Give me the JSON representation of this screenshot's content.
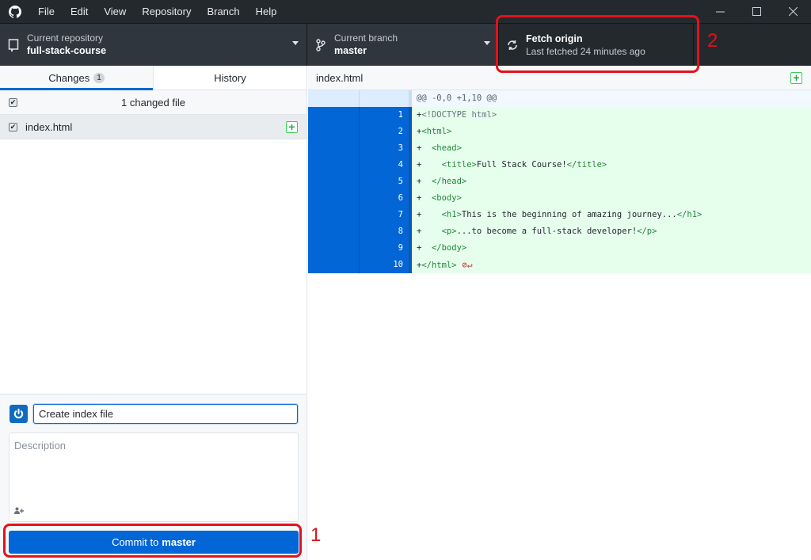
{
  "titlebar": {
    "menu": [
      "File",
      "Edit",
      "View",
      "Repository",
      "Branch",
      "Help"
    ],
    "window_controls": [
      "minimize",
      "maximize",
      "close"
    ]
  },
  "toolbar": {
    "repository": {
      "label": "Current repository",
      "value": "full-stack-course"
    },
    "branch": {
      "label": "Current branch",
      "value": "master"
    },
    "fetch": {
      "label": "Fetch origin",
      "sub": "Last fetched 24 minutes ago"
    }
  },
  "annotations": {
    "fetch_number": "2",
    "commit_number": "1"
  },
  "sidebar": {
    "tabs": [
      {
        "label": "Changes",
        "badge": "1",
        "selected": true
      },
      {
        "label": "History",
        "selected": false
      }
    ],
    "changes_header": "1 changed file",
    "files": [
      {
        "name": "index.html",
        "status": "added",
        "checked": true
      }
    ]
  },
  "commit": {
    "summary_value": "Create index file",
    "description_placeholder": "Description",
    "button_prefix": "Commit to",
    "button_branch": "master"
  },
  "diff": {
    "filename": "index.html",
    "hunk": "@@ -0,0 +1,10 @@",
    "lines": [
      {
        "num": "1",
        "parts": [
          [
            "p",
            "+"
          ],
          [
            "d",
            "<!DOCTYPE html>"
          ]
        ]
      },
      {
        "num": "2",
        "parts": [
          [
            "p",
            "+"
          ],
          [
            "t",
            "<html>"
          ]
        ]
      },
      {
        "num": "3",
        "parts": [
          [
            "p",
            "+  "
          ],
          [
            "t",
            "<head>"
          ]
        ]
      },
      {
        "num": "4",
        "parts": [
          [
            "p",
            "+    "
          ],
          [
            "t",
            "<title>"
          ],
          [
            "x",
            "Full Stack Course!"
          ],
          [
            "t",
            "</title>"
          ]
        ]
      },
      {
        "num": "5",
        "parts": [
          [
            "p",
            "+  "
          ],
          [
            "t",
            "</head>"
          ]
        ]
      },
      {
        "num": "6",
        "parts": [
          [
            "p",
            "+  "
          ],
          [
            "t",
            "<body>"
          ]
        ]
      },
      {
        "num": "7",
        "parts": [
          [
            "p",
            "+    "
          ],
          [
            "t",
            "<h1>"
          ],
          [
            "x",
            "This is the beginning of amazing journey..."
          ],
          [
            "t",
            "</h1>"
          ]
        ]
      },
      {
        "num": "8",
        "parts": [
          [
            "p",
            "+    "
          ],
          [
            "t",
            "<p>"
          ],
          [
            "x",
            "...to become a full-stack developer!"
          ],
          [
            "t",
            "</p>"
          ]
        ]
      },
      {
        "num": "9",
        "parts": [
          [
            "p",
            "+  "
          ],
          [
            "t",
            "</body>"
          ]
        ]
      },
      {
        "num": "10",
        "parts": [
          [
            "p",
            "+"
          ],
          [
            "t",
            "</html>"
          ],
          [
            "w",
            " ⊘↵"
          ]
        ]
      }
    ]
  },
  "colors": {
    "accent": "#0366d6",
    "added": "#28a745",
    "annotation": "#e5111b",
    "toolbar_bg": "#24292e"
  }
}
